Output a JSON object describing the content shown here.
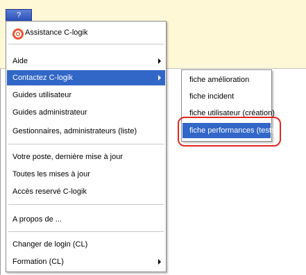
{
  "toolbar": {
    "help_button_label": "?"
  },
  "main_menu": {
    "items": [
      {
        "label": "Assistance C-logik",
        "icon": "lifebuoy-icon"
      },
      {
        "label": "Aide",
        "submenu": true
      },
      {
        "label": "Contactez C-logik",
        "submenu": true,
        "highlighted": true
      },
      {
        "label": "Guides utilisateur"
      },
      {
        "label": "Guides administrateur"
      },
      {
        "label": "Gestionnaires, administrateurs (liste)"
      },
      {
        "label": "Votre poste, dernière mise à jour"
      },
      {
        "label": "Toutes les mises à jour"
      },
      {
        "label": "Accès reservé C-logik"
      },
      {
        "label": "A propos de ..."
      },
      {
        "label": "Changer de login (CL)"
      },
      {
        "label": "Formation (CL)",
        "submenu": true
      }
    ]
  },
  "sub_menu": {
    "items": [
      {
        "label": "fiche amélioration"
      },
      {
        "label": "fiche incident"
      },
      {
        "label": "fiche utilisateur (création)"
      },
      {
        "label": "fiche performances (tests)",
        "highlighted": true
      }
    ]
  },
  "colors": {
    "highlight": "#3267c8",
    "annotation_ring": "#e0261f",
    "background_band": "#fff8d6"
  }
}
